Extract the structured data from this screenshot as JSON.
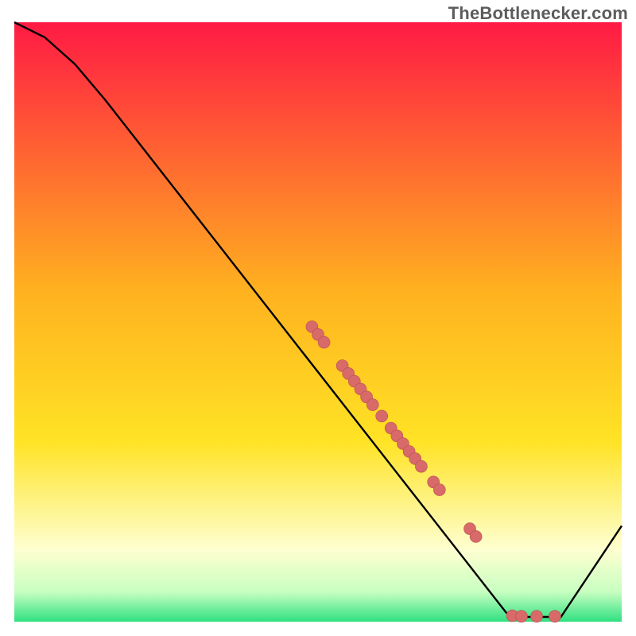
{
  "watermark": {
    "text": "TheBottlenecker.com"
  },
  "colors": {
    "curve": "#000000",
    "dot_fill": "#d86a6a",
    "dot_stroke": "#b84f4f",
    "border": "#ffffff",
    "gradient_top": "#ff1a44",
    "gradient_mid1": "#ff8a1f",
    "gradient_mid2": "#ffe325",
    "gradient_pale": "#feffd0",
    "gradient_green": "#30e081"
  },
  "chart_data": {
    "type": "line",
    "title": "",
    "xlabel": "",
    "ylabel": "",
    "xlim": [
      0,
      100
    ],
    "ylim": [
      0,
      100
    ],
    "curve": [
      {
        "x": 0,
        "y": 100
      },
      {
        "x": 5,
        "y": 97.5
      },
      {
        "x": 10,
        "y": 93
      },
      {
        "x": 15,
        "y": 87
      },
      {
        "x": 81,
        "y": 1.5
      },
      {
        "x": 83,
        "y": 0.8
      },
      {
        "x": 90,
        "y": 0.8
      },
      {
        "x": 100,
        "y": 16
      }
    ],
    "scatter_on_curve": [
      {
        "x": 49.0,
        "y": 49.2
      },
      {
        "x": 50.0,
        "y": 47.9
      },
      {
        "x": 51.0,
        "y": 46.6
      },
      {
        "x": 54.0,
        "y": 42.7
      },
      {
        "x": 55.0,
        "y": 41.4
      },
      {
        "x": 56.0,
        "y": 40.1
      },
      {
        "x": 57.0,
        "y": 38.8
      },
      {
        "x": 58.0,
        "y": 37.5
      },
      {
        "x": 59.0,
        "y": 36.2
      },
      {
        "x": 60.5,
        "y": 34.3
      },
      {
        "x": 62.0,
        "y": 32.3
      },
      {
        "x": 63.0,
        "y": 31.0
      },
      {
        "x": 64.0,
        "y": 29.7
      },
      {
        "x": 65.0,
        "y": 28.4
      },
      {
        "x": 66.0,
        "y": 27.2
      },
      {
        "x": 67.0,
        "y": 25.9
      },
      {
        "x": 69.0,
        "y": 23.3
      },
      {
        "x": 70.0,
        "y": 22.0
      },
      {
        "x": 75.0,
        "y": 15.5
      },
      {
        "x": 76.0,
        "y": 14.2
      }
    ],
    "scatter_bottom": [
      {
        "x": 82.0,
        "y": 1.0
      },
      {
        "x": 83.5,
        "y": 0.9
      },
      {
        "x": 86.0,
        "y": 0.9
      },
      {
        "x": 89.0,
        "y": 0.9
      }
    ]
  }
}
